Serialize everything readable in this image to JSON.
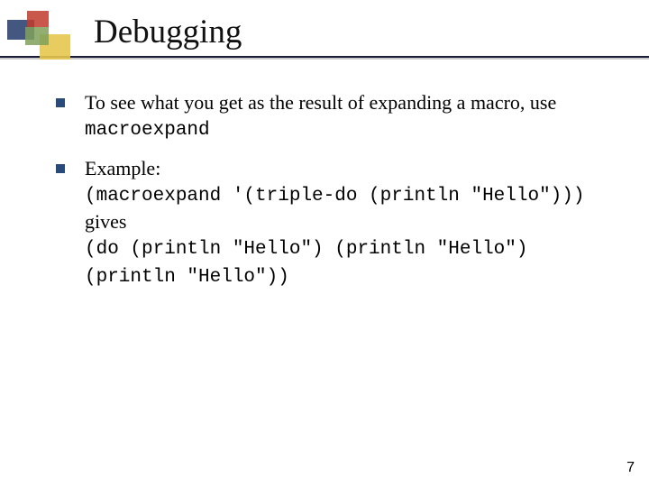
{
  "title": "Debugging",
  "items": [
    {
      "lead": "To see what you get as the result of expanding a macro, use ",
      "code": "macroexpand"
    },
    {
      "lead": "Example:",
      "code_line_1": "(macroexpand '(triple-do (println \"Hello\")))",
      "mid": "gives",
      "code_line_2a": "(do (println \"Hello\")  (println \"Hello\")",
      "code_line_2b": "(println \"Hello\"))"
    }
  ],
  "page_number": "7"
}
